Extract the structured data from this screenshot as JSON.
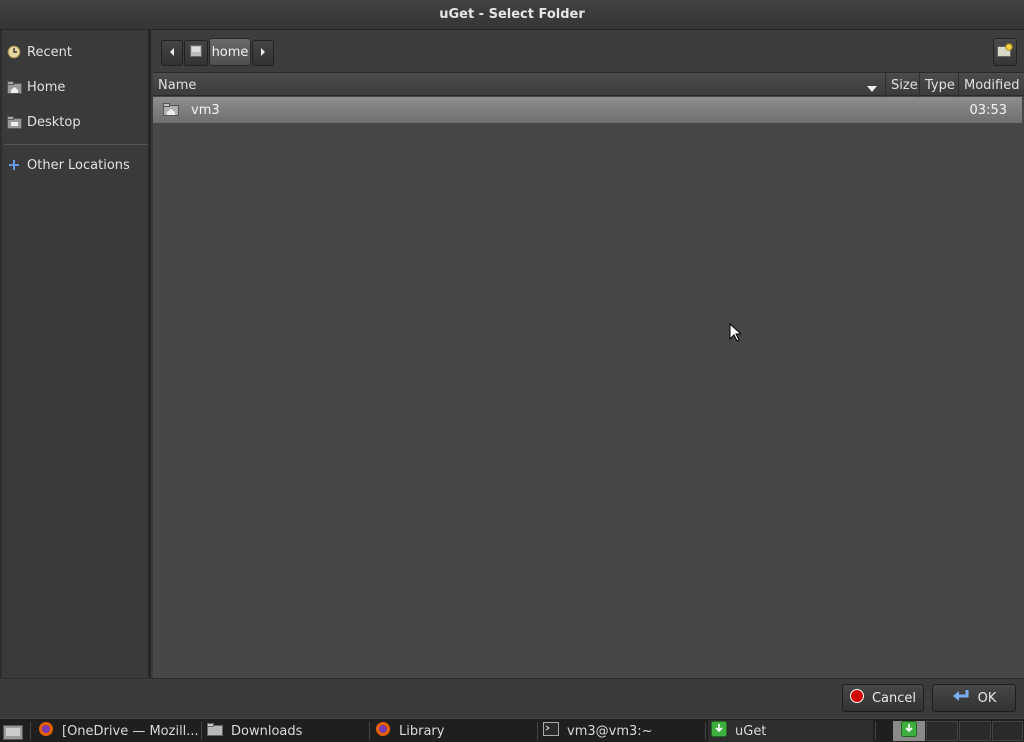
{
  "window": {
    "title": "uGet - Select Folder"
  },
  "sidebar": {
    "items": [
      {
        "label": "Recent",
        "icon": "clock-icon"
      },
      {
        "label": "Home",
        "icon": "home-folder-icon"
      },
      {
        "label": "Desktop",
        "icon": "desktop-folder-icon"
      }
    ],
    "other": {
      "label": "Other Locations",
      "icon": "plus-icon"
    }
  },
  "pathbar": {
    "current": "home"
  },
  "columns": {
    "name": "Name",
    "size": "Size",
    "type": "Type",
    "modified": "Modified"
  },
  "files": [
    {
      "name": "vm3",
      "size": "",
      "type": "",
      "modified": "03:53",
      "icon": "folder-icon",
      "selected": true
    }
  ],
  "buttons": {
    "cancel": "Cancel",
    "ok": "OK"
  },
  "taskbar": {
    "tasks": [
      {
        "label": "[OneDrive — Mozill...",
        "icon": "firefox-icon"
      },
      {
        "label": "Downloads",
        "icon": "folder-icon"
      },
      {
        "label": "Library",
        "icon": "firefox-icon"
      },
      {
        "label": "vm3@vm3:~",
        "icon": "terminal-icon"
      },
      {
        "label": "uGet",
        "icon": "uget-icon",
        "active": true
      }
    ]
  },
  "colors": {
    "accent_green": "#3fae3f",
    "selection": "#7d7d7d",
    "cancel_red": "#d00000"
  }
}
